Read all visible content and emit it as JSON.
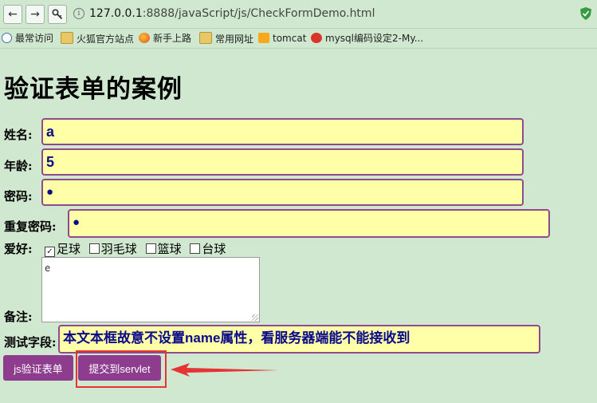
{
  "browser": {
    "url_host": "127.0.0.1",
    "url_port": ":8888",
    "url_path": "/javaScript/js/CheckFormDemo.html",
    "bookmarks": [
      {
        "label": "最常访问",
        "icon": "search-icon"
      },
      {
        "label": "火狐官方站点",
        "icon": "folder-icon"
      },
      {
        "label": "新手上路",
        "icon": "firefox-icon"
      },
      {
        "label": "常用网址",
        "icon": "folder-icon"
      },
      {
        "label": "tomcat",
        "icon": "tomcat-icon"
      },
      {
        "label": "mysql编码设定2-My...",
        "icon": "php-icon"
      }
    ]
  },
  "page": {
    "title": "验证表单的案例"
  },
  "form": {
    "name_label": "姓名:",
    "name_value": "a",
    "age_label": "年龄:",
    "age_value": "5",
    "password_label": "密码:",
    "password_value": "●",
    "repeat_password_label": "重复密码:",
    "repeat_password_value": "●",
    "hobby_label": "爱好:",
    "hobbies": [
      {
        "label": "足球",
        "checked": true
      },
      {
        "label": "羽毛球",
        "checked": false
      },
      {
        "label": "篮球",
        "checked": false
      },
      {
        "label": "台球",
        "checked": false
      }
    ],
    "remark_label": "备注:",
    "remark_value": "e",
    "test_label": "测试字段:",
    "test_value": "本文本框故意不设置name属性，看服务器端能不能接收到",
    "js_validate_button": "js验证表单",
    "submit_button": "提交到servlet"
  },
  "colors": {
    "page_background": "#cfe8cf",
    "input_background": "#ffffa8",
    "input_border": "#8e4c8e",
    "button_background": "#8e3d8e",
    "highlight_red": "#e53434"
  }
}
